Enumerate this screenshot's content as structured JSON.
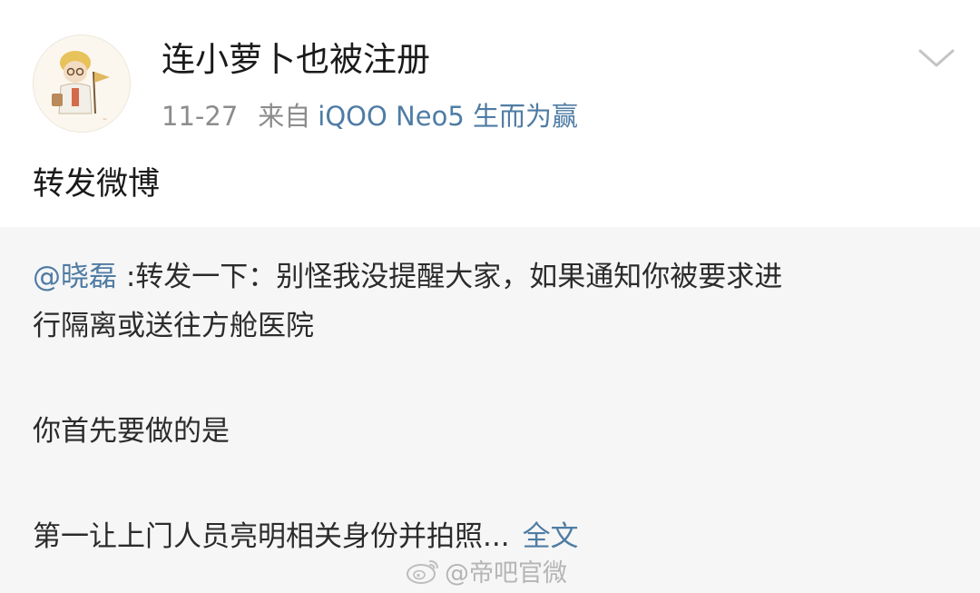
{
  "post": {
    "author": "连小萝卜也被注册",
    "date": "11-27",
    "from_label": "来自",
    "device": "iQOO Neo5 生而为赢",
    "repost_text": "转发微博"
  },
  "quoted": {
    "mention": "@晓磊",
    "line1_rest": ":转发一下：别怪我没提醒大家，如果通知你被要求进",
    "line2": "行隔离或送往方舱医院",
    "line3": "你首先要做的是",
    "line4": "第一让上门人员亮明相关身份并拍照...",
    "full_text_link": "全文"
  },
  "watermark": {
    "text": "@帝吧官微"
  },
  "icons": {
    "expand": "chevron-down-icon",
    "weibo": "weibo-logo-icon"
  },
  "colors": {
    "link": "#4f7ca4",
    "meta": "#8c8c8c",
    "quoted_bg": "#f6f6f6",
    "text": "#1a1a1a"
  }
}
